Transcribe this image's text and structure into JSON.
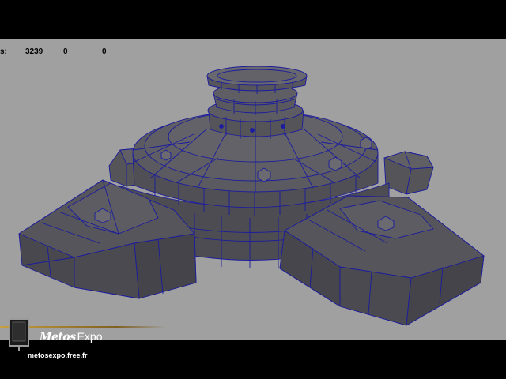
{
  "hud": {
    "label": "s:",
    "value_1": "3239",
    "value_2": "0",
    "value_3": "0"
  },
  "logo": {
    "brand": "Metos",
    "expo": "Expo",
    "url": "metosexpo.free.fr"
  },
  "colors": {
    "viewport_background": "#a0a0a0",
    "mesh_face": "#4a4a50",
    "wireframe": "#1a1a9a",
    "letterbox": "#000000"
  },
  "icons": [
    "monitor-logo-icon"
  ]
}
